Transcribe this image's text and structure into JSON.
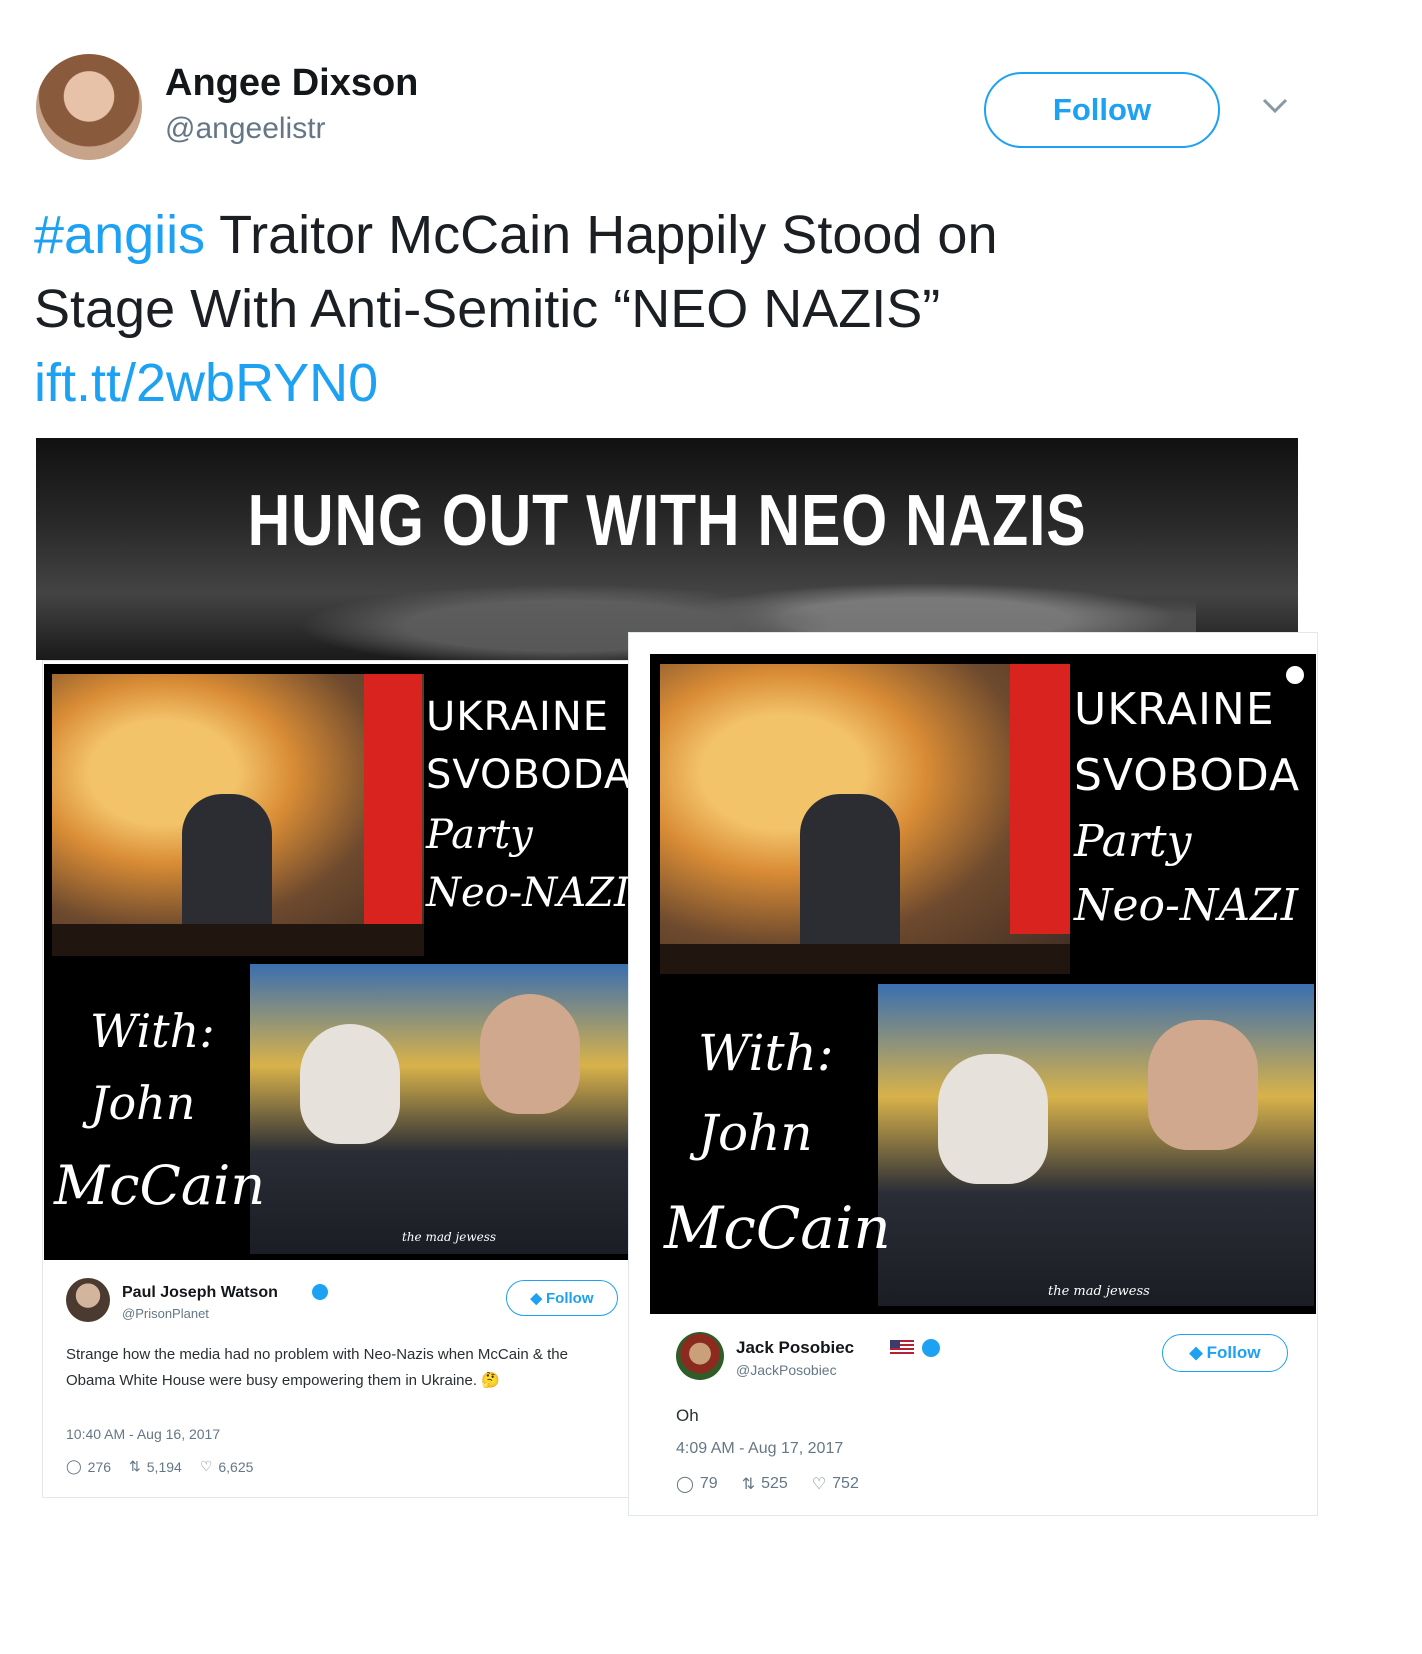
{
  "tweet": {
    "author_name": "Angee Dixson",
    "author_handle": "@angeelistr",
    "follow_label": "Follow",
    "hashtag": "#angiis",
    "text_line1": " Traitor McCain Happily Stood on",
    "text_line2": "Stage With Anti-Semitic “NEO NAZIS”",
    "link": "ift.tt/2wbRYN0"
  },
  "banner": {
    "title": "HUNG OUT WITH NEO NAZIS"
  },
  "meme": {
    "line1": "UKRAINE",
    "line2": "SVOBODA",
    "line3": "Party",
    "line4": "Neo-NAZI",
    "with": "With:",
    "john": "John",
    "mccain": "McCain",
    "credit": "the mad jewess"
  },
  "embed_left": {
    "name": "Paul Joseph Watson",
    "handle": "@PrisonPlanet",
    "follow_label": "Follow",
    "text": "Strange how the media had no problem with Neo-Nazis when McCain & the Obama White House were busy empowering them in Ukraine. 🤔",
    "timestamp": "10:40 AM - Aug 16, 2017",
    "replies": "276",
    "retweets": "5,194",
    "likes": "6,625"
  },
  "embed_right": {
    "name": "Jack Posobiec",
    "handle": "@JackPosobiec",
    "follow_label": "Follow",
    "text": "Oh",
    "timestamp": "4:09 AM - Aug 17, 2017",
    "replies": "79",
    "retweets": "525",
    "likes": "752"
  },
  "colors": {
    "twitter_blue": "#1da1f2",
    "text": "#14171a",
    "muted": "#657786"
  }
}
